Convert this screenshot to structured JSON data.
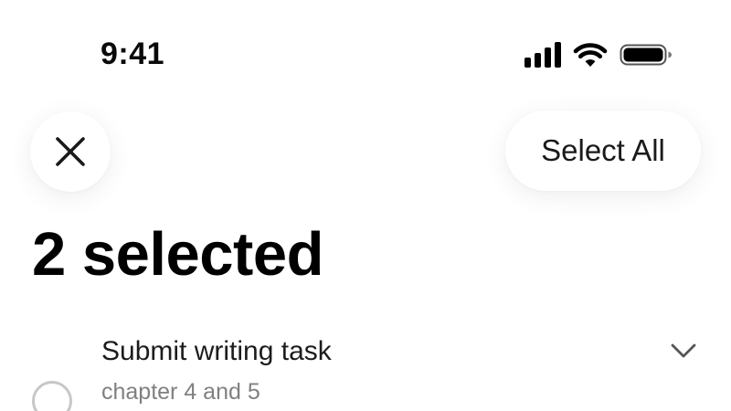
{
  "status_bar": {
    "time": "9:41",
    "icons": [
      "signal-icon",
      "wifi-icon",
      "battery-icon"
    ]
  },
  "toolbar": {
    "close_icon": "close-icon",
    "select_all_label": "Select All"
  },
  "header": {
    "title": "2 selected"
  },
  "tasks": [
    {
      "title": "Submit writing task",
      "subtitle": "chapter 4 and 5",
      "checked": false,
      "expand_icon": "chevron-down-icon"
    }
  ],
  "colors": {
    "background": "#ffffff",
    "text_primary": "#000000",
    "text_secondary": "#808080",
    "checkbox_border": "#c7c7c7"
  }
}
